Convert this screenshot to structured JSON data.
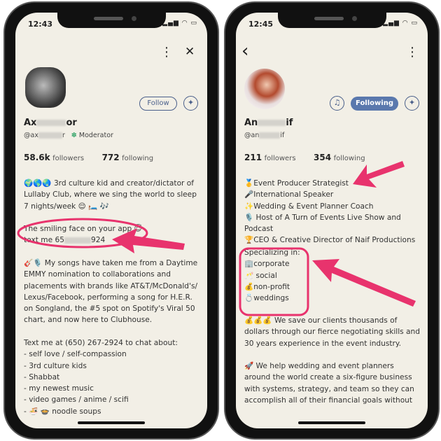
{
  "left": {
    "time": "12:43",
    "status_icons": "signal-wifi-battery",
    "more_icon": "⋮",
    "close_icon": "✕",
    "follow_label": "Follow",
    "name_start": "Ax",
    "name_end": "or",
    "handle_start": "@ax",
    "handle_end": "r",
    "moderator_label": "Moderator",
    "followers_count": "58.6k",
    "followers_label": "followers",
    "following_count": "772",
    "following_label": "following",
    "bio_1": "🌍🌎🌏 3rd culture kid and creator/dictator of Lullaby Club, where we sing the world to sleep 7 nights/week 😌 🛏️ 🎶",
    "bio_2a": "The smiling face on your app 😇",
    "bio_2b_start": "text me 65",
    "bio_2b_end": "924",
    "bio_3": "🎸🎙️ My songs have taken me from a Daytime EMMY nomination to collaborations and placements with brands like AT&T/McDonald's/ Lexus/Facebook, performing a song for H.E.R. on Songland, the #5 spot on Spotify's Viral 50 chart, and now here to Clubhouse.",
    "bio_4": "Text me at (650) 267-2924 to chat about:\n- self love / self-compassion\n- 3rd culture kids\n- Shabbat\n- my newest music\n- video games / anime / scifi\n- 🍜 🍲 noodle soups"
  },
  "right": {
    "time": "12:45",
    "back_icon": "‹",
    "more_icon": "⋮",
    "following_button": "Following",
    "name_start": "An",
    "name_end": "if",
    "handle_start": "@an",
    "handle_end": "if",
    "followers_count": "211",
    "followers_label": "followers",
    "following_count": "354",
    "following_label": "following",
    "bio_1": "🥇Event Producer Strategist\n🎤International Speaker\n✨Wedding & Event Planner Coach\n🎙️ Host of A Turn of Events Live Show and Podcast\n🏆CEO & Creative Director of Naif Productions",
    "bio_2": "Specializing in:\n🏢corporate\n🥂 social\n💰non-profit\n💍weddings",
    "bio_3": "💰💰💰 We save our clients thousands of dollars through our fierce negotiating skills and 30 years experience in the event industry.",
    "bio_4": "🚀 We help wedding and event planners around the world create a six-figure business with systems, strategy, and team so they can accomplish all of their financial goals without"
  },
  "colors": {
    "accent": "#5a78ad",
    "annotation": "#e8336d",
    "background": "#f2efe6"
  }
}
